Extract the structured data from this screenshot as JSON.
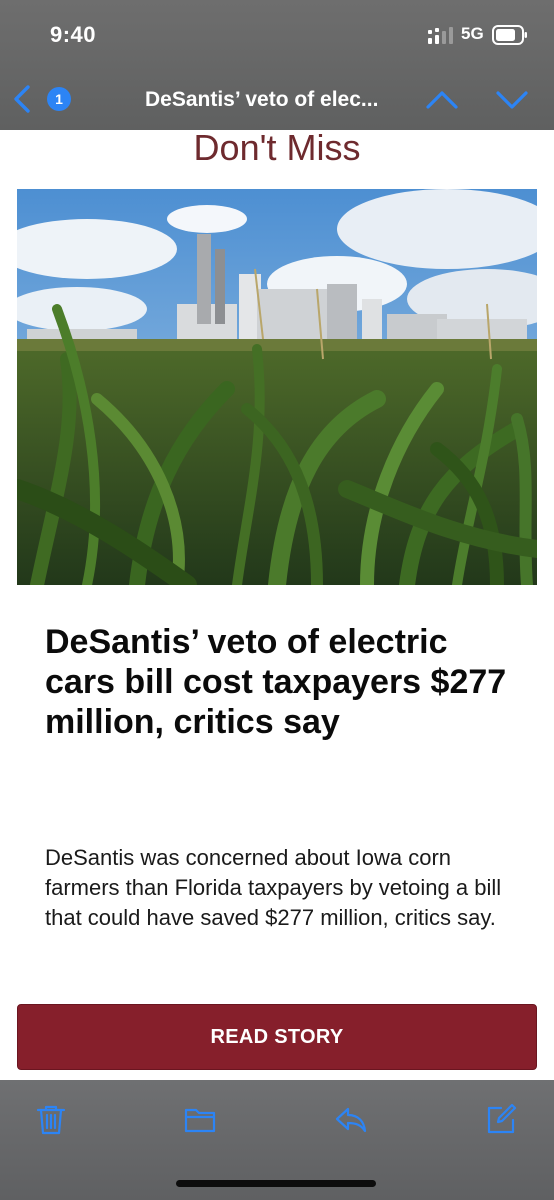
{
  "status_bar": {
    "time": "9:40",
    "network": "5G",
    "icons": [
      "cellular-signal-icon",
      "battery-icon"
    ]
  },
  "nav": {
    "unread_count": "1",
    "title": "DeSantis’ veto of elec...",
    "icons": [
      "chevron-left-icon",
      "chevron-up-icon",
      "chevron-down-icon"
    ]
  },
  "content": {
    "section_heading": "Don't Miss",
    "image_alt": "corn-field-with-ethanol-plant-image",
    "headline": "DeSantis’ veto of electric cars bill cost taxpayers $277 million, critics say",
    "summary": "DeSantis was concerned about Iowa corn farmers than Florida taxpayers by vetoing a bill that could have saved $277 million, critics say.",
    "cta_label": "READ STORY"
  },
  "toolbar": {
    "icons": [
      "trash-icon",
      "folder-icon",
      "reply-icon",
      "compose-icon"
    ]
  },
  "colors": {
    "accent_blue": "#2c84f5",
    "heading_maroon": "#6e2a2e",
    "button_maroon": "#861f2b",
    "chrome_gray": "#676869"
  }
}
